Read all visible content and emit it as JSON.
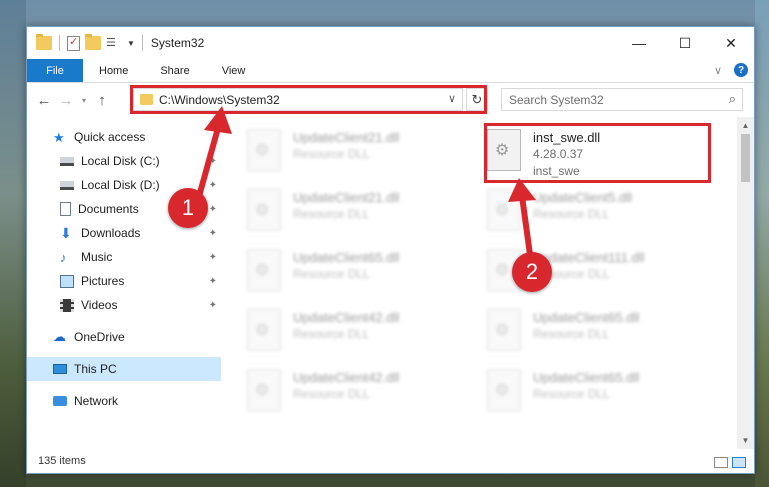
{
  "window": {
    "title": "System32"
  },
  "window_controls": {
    "minimize": "—",
    "maximize": "☐",
    "close": "✕"
  },
  "ribbon": {
    "tabs": [
      "File",
      "Home",
      "Share",
      "View"
    ]
  },
  "address": {
    "path": "C:\\Windows\\System32"
  },
  "search": {
    "placeholder": "Search System32"
  },
  "nav": {
    "items": [
      {
        "label": "Quick access",
        "icon": "star-icon"
      },
      {
        "label": "Local Disk (C:)",
        "icon": "disk-icon"
      },
      {
        "label": "Local Disk (D:)",
        "icon": "disk-icon"
      },
      {
        "label": "Documents",
        "icon": "documents-icon"
      },
      {
        "label": "Downloads",
        "icon": "downloads-icon"
      },
      {
        "label": "Music",
        "icon": "music-icon"
      },
      {
        "label": "Pictures",
        "icon": "pictures-icon"
      },
      {
        "label": "Videos",
        "icon": "videos-icon"
      },
      {
        "label": "OneDrive",
        "icon": "onedrive-icon"
      },
      {
        "label": "This PC",
        "icon": "this-pc-icon"
      },
      {
        "label": "Network",
        "icon": "network-icon"
      }
    ]
  },
  "files": [
    {
      "name": "UpdateClient21.dll",
      "sub": "Resource DLL"
    },
    {
      "name": "inst_swe.dll",
      "version": "4.28.0.37",
      "desc": "inst_swe"
    },
    {
      "name": "UpdateClient21.dll",
      "sub": "Resource DLL"
    },
    {
      "name": "UpdateClient5.dll",
      "sub": "Resource DLL"
    },
    {
      "name": "UpdateClient65.dll",
      "sub": "Resource DLL"
    },
    {
      "name": "UpdateClient111.dll",
      "sub": "Resource DLL"
    },
    {
      "name": "UpdateClient42.dll",
      "sub": "Resource DLL"
    },
    {
      "name": "UpdateClient65.dll",
      "sub": "Resource DLL"
    },
    {
      "name": "UpdateClient42.dll",
      "sub": "Resource DLL"
    },
    {
      "name": "UpdateClient65.dll",
      "sub": "Resource DLL"
    }
  ],
  "status": {
    "item_count": "135 items"
  },
  "annotations": {
    "badge1": "1",
    "badge2": "2",
    "color": "#d9272e"
  }
}
